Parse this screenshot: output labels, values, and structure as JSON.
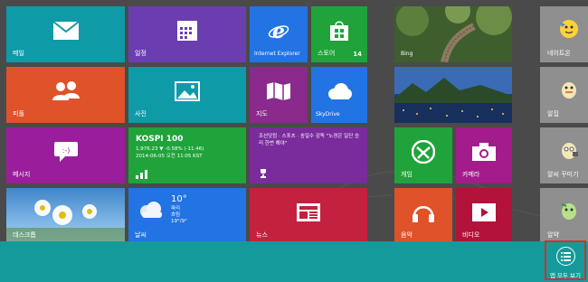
{
  "colors": {
    "background": "#4a4a4a",
    "taskbar": "#149a9a",
    "mail": "#0e9aa7",
    "calendar": "#6a3eb0",
    "ie": "#2273e3",
    "store": "#1fa33a",
    "people": "#e0522a",
    "photos": "#0e9aa7",
    "maps": "#8a2a8c",
    "skydrive": "#2273e3",
    "messaging": "#9a1e9c",
    "finance": "#1fa33a",
    "news": "#c4213f",
    "games": "#1fa33a",
    "camera": "#a21c8c",
    "music": "#e0522a",
    "video": "#b3133a",
    "highlight": "#d32f2f"
  },
  "tiles": {
    "mail": {
      "label": "메일",
      "icon": "envelope-icon"
    },
    "calendar": {
      "label": "일정",
      "icon": "calendar-icon"
    },
    "ie": {
      "label": "Internet Explorer",
      "icon": "internet-explorer-icon"
    },
    "store": {
      "label": "스토어",
      "badge": "14",
      "icon": "store-bag-icon"
    },
    "bing": {
      "label": "Bing"
    },
    "people": {
      "label": "피플",
      "icon": "people-icon"
    },
    "photos": {
      "label": "사진",
      "icon": "photo-icon"
    },
    "maps": {
      "label": "지도",
      "icon": "map-icon"
    },
    "skydrive": {
      "label": "SkyDrive",
      "icon": "cloud-icon"
    },
    "messaging": {
      "label": "메시지",
      "icon": "chat-bubble-icon"
    },
    "finance": {
      "ticker": "KOSPI 100",
      "line1": "1,976.23  ▼ -0.58% (-11.46)",
      "line2": "2014-06-05 오전 11:05 KST"
    },
    "news_top": {
      "text": "조선닷컴 · 스포츠 · 송일수 감독 \"노경은 일단 승리 한번 해야\""
    },
    "games": {
      "label": "게임",
      "icon": "gamepad-icon"
    },
    "camera": {
      "label": "카메라",
      "icon": "camera-icon"
    },
    "desktop": {
      "label": "데스크톱"
    },
    "weather": {
      "label": "날씨",
      "temp": "10°",
      "city": "파리",
      "cond": "흐림",
      "range": "19°/9°"
    },
    "news": {
      "label": "뉴스",
      "icon": "newspaper-icon"
    },
    "music": {
      "label": "음악",
      "icon": "headphones-icon"
    },
    "video": {
      "label": "비디오",
      "icon": "play-icon"
    }
  },
  "right_column": [
    {
      "label": "네이트온"
    },
    {
      "label": "알집"
    },
    {
      "label": "알씨 꾸미기"
    },
    {
      "label": "알약"
    }
  ],
  "all_apps": {
    "label": "앱 모두 보기",
    "icon": "all-apps-icon"
  }
}
